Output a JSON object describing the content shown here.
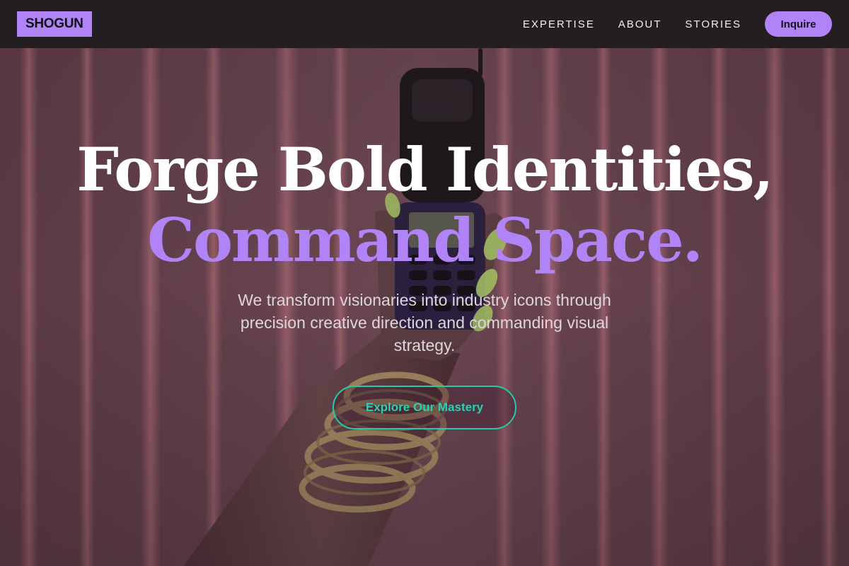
{
  "nav": {
    "logo": "SHOGUN",
    "links": [
      "EXPERTISE",
      "ABOUT",
      "STORIES"
    ],
    "cta_label": "Inquire"
  },
  "hero": {
    "headline_line1": "Forge Bold Identities,",
    "headline_line2": "Command Space.",
    "subtitle": "We transform visionaries into industry icons through precision creative direction and commanding visual strategy.",
    "cta_label": "Explore Our Mastery",
    "background_image": "hand holding flip phone with gold chain bracelets in front of pink curtain"
  },
  "colors": {
    "accent": "#b084f6",
    "teal": "#27c9a9",
    "nav_bg": "#231f20",
    "curtain": "#6e4852"
  }
}
